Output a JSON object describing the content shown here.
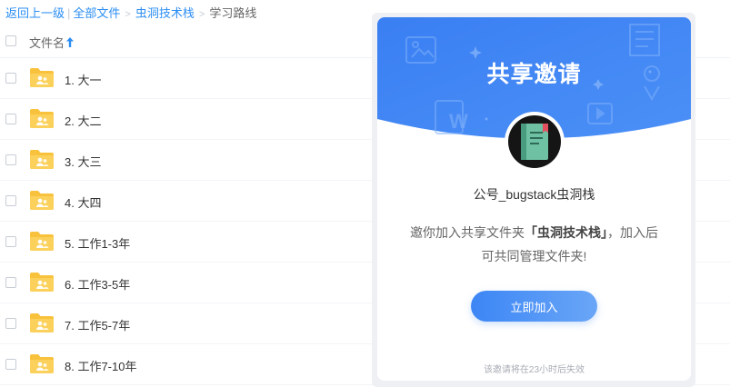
{
  "breadcrumb": {
    "back": "返回上一级",
    "all_files": "全部文件",
    "folder": "虫洞技术栈",
    "current": "学习路线"
  },
  "list": {
    "column_name": "文件名",
    "sort_icon": "arrow-up-icon",
    "rows": [
      {
        "name": "1. 大一"
      },
      {
        "name": "2. 大二"
      },
      {
        "name": "3. 大三"
      },
      {
        "name": "4. 大四"
      },
      {
        "name": "5. 工作1-3年"
      },
      {
        "name": "6. 工作3-5年"
      },
      {
        "name": "7. 工作5-7年"
      },
      {
        "name": "8. 工作7-10年"
      }
    ]
  },
  "invite": {
    "title": "共享邀请",
    "owner": "公号_bugstack虫洞栈",
    "desc_prefix": "邀你加入共享文件夹",
    "desc_folder": "「虫洞技术栈」",
    "desc_suffix": "，加入后",
    "desc_line2": "可共同管理文件夹!",
    "join_button": "立即加入",
    "expire_note": "该邀请将在23小时后失效"
  },
  "colors": {
    "accent": "#2b8ef3",
    "banner": "#3d84f5",
    "folder": "#f9c23c"
  }
}
